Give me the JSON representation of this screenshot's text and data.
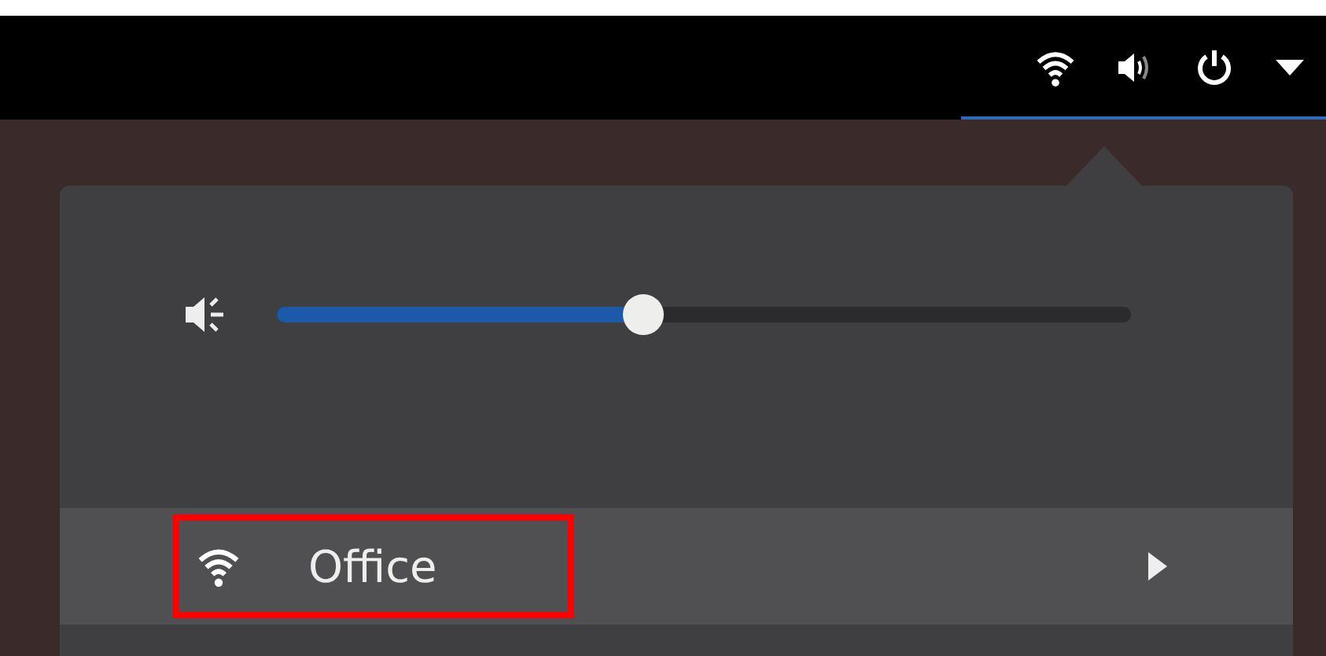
{
  "top_bar": {
    "status_menu_open": true
  },
  "system_menu": {
    "volume": {
      "level": 0.43
    },
    "network": {
      "label": "Office",
      "highlighted": true
    }
  }
}
